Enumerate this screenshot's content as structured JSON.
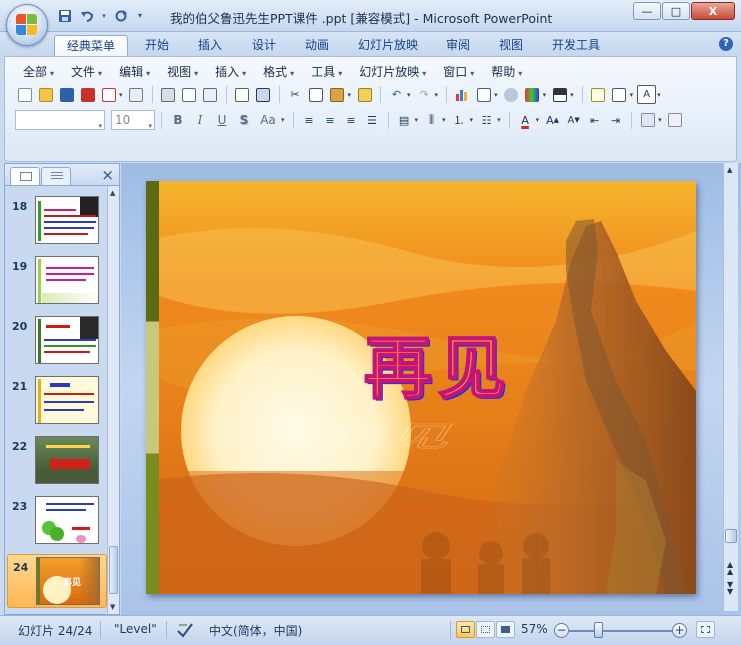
{
  "window": {
    "title": "我的伯父鲁迅先生PPT课件 .ppt [兼容模式] - Microsoft PowerPoint",
    "controls": {
      "minimize": "—",
      "maximize": "□",
      "close": "X"
    }
  },
  "quick_access": {
    "save_icon": "save-icon",
    "undo_icon": "undo-icon",
    "redo_icon": "redo-icon",
    "customize_icon": "customize-icon"
  },
  "tabs": [
    "经典菜单",
    "开始",
    "插入",
    "设计",
    "动画",
    "幻灯片放映",
    "审阅",
    "视图",
    "开发工具"
  ],
  "active_tab": "经典菜单",
  "help_label": "?",
  "menu": [
    "全部",
    "文件",
    "编辑",
    "视图",
    "插入",
    "格式",
    "工具",
    "幻灯片放映",
    "窗口",
    "帮助"
  ],
  "font": {
    "name_value": "",
    "size_value": "10",
    "bold": "B",
    "italic": "I",
    "underline": "U",
    "shadow": "S",
    "case": "Aa"
  },
  "slides_panel": {
    "thumbnails": [
      {
        "number": "18"
      },
      {
        "number": "19"
      },
      {
        "number": "20"
      },
      {
        "number": "21"
      },
      {
        "number": "22"
      },
      {
        "number": "23"
      },
      {
        "number": "24"
      }
    ],
    "selected": "24"
  },
  "slide": {
    "title_text": "再见",
    "thumbnail_text": "再见",
    "colors": {
      "sky_top": "#e8801a",
      "sun": "#fff6d0",
      "left_band": "#5c6b12",
      "title_magenta": "#d0127a",
      "title_blue": "#1f36d6"
    }
  },
  "status": {
    "slide_counter": "幻灯片 24/24",
    "theme": "\"Level\"",
    "language": "中文(简体，中国)",
    "zoom": "57%",
    "zoom_minus": "−",
    "zoom_plus": "+"
  }
}
